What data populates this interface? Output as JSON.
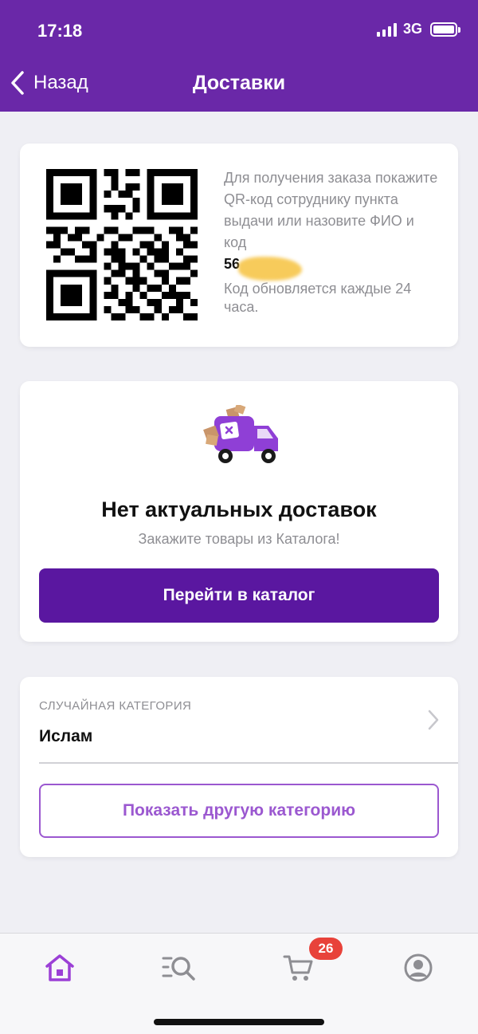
{
  "status": {
    "time": "17:18",
    "network": "3G"
  },
  "nav": {
    "back_label": "Назад",
    "title": "Доставки"
  },
  "qr_card": {
    "instructions": "Для получения заказа покажите QR-код сотруднику пункта выдачи или назовите ФИО и код",
    "code_visible": "56",
    "note": "Код обновляется каждые 24 часа."
  },
  "empty_state": {
    "title": "Нет актуальных доставок",
    "subtitle": "Закажите товары из Каталога!",
    "button_label": "Перейти в каталог"
  },
  "random_category": {
    "label": "СЛУЧАЙНАЯ КАТЕГОРИЯ",
    "value": "Ислам",
    "button_label": "Показать другую категорию"
  },
  "tabbar": {
    "items": [
      {
        "icon": "home-icon",
        "active": true
      },
      {
        "icon": "catalog-search-icon",
        "active": false
      },
      {
        "icon": "cart-icon",
        "active": false
      },
      {
        "icon": "profile-icon",
        "active": false
      }
    ],
    "cart_badge": "26"
  },
  "colors": {
    "brand": "#6a28a8",
    "button": "#5a17a0",
    "accent": "#9b58d0",
    "badge": "#e8423a"
  }
}
